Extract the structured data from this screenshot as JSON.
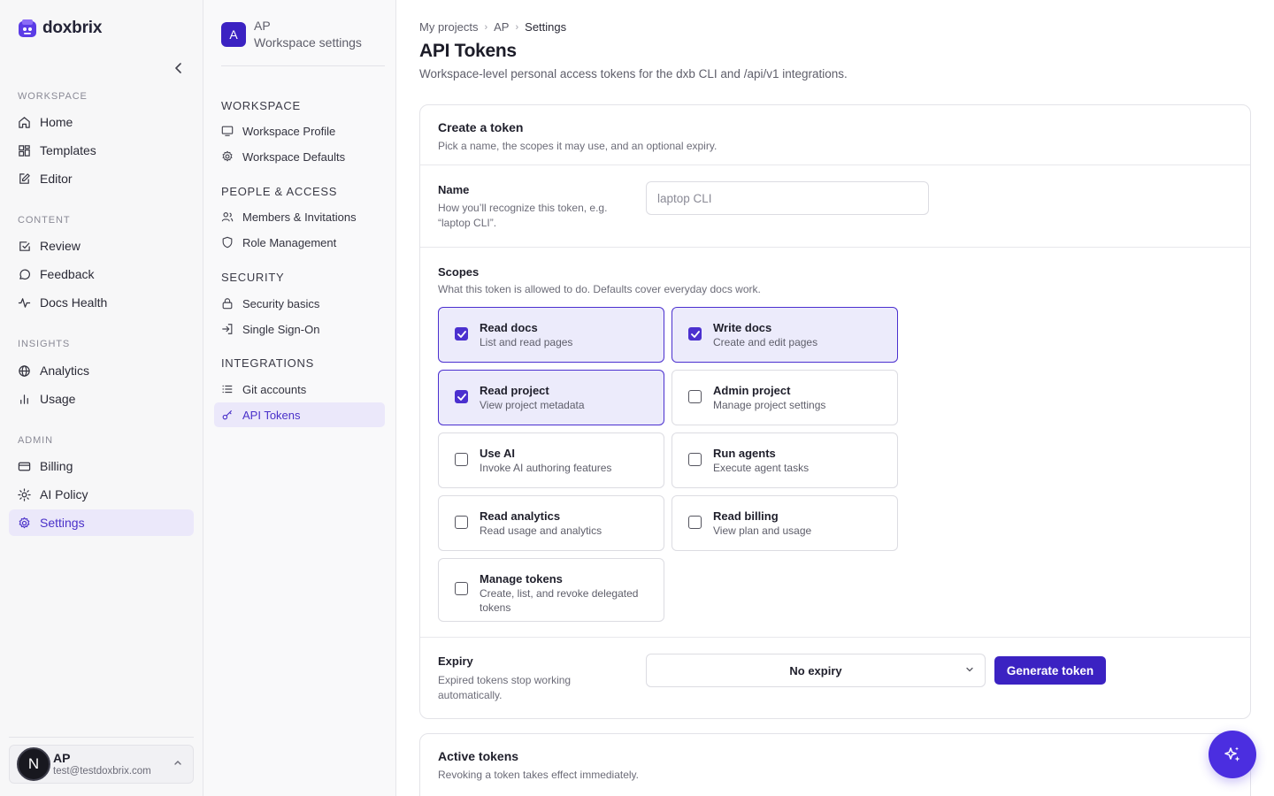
{
  "app": {
    "brand": "doxbrix",
    "colors": {
      "accent": "#3b22c2",
      "active_bg": "#ebe8fa",
      "active_text": "#4a31c9"
    }
  },
  "sidebar": {
    "sections": [
      {
        "label": "WORKSPACE",
        "items": [
          {
            "label": "Home",
            "icon": "home-icon"
          },
          {
            "label": "Templates",
            "icon": "grid-icon"
          },
          {
            "label": "Editor",
            "icon": "edit-icon"
          }
        ]
      },
      {
        "label": "CONTENT",
        "items": [
          {
            "label": "Review",
            "icon": "check-square-icon"
          },
          {
            "label": "Feedback",
            "icon": "message-icon"
          },
          {
            "label": "Docs Health",
            "icon": "pulse-icon"
          }
        ]
      },
      {
        "label": "INSIGHTS",
        "items": [
          {
            "label": "Analytics",
            "icon": "globe-icon"
          },
          {
            "label": "Usage",
            "icon": "bar-chart-icon"
          }
        ]
      },
      {
        "label": "ADMIN",
        "items": [
          {
            "label": "Billing",
            "icon": "credit-card-icon"
          },
          {
            "label": "AI Policy",
            "icon": "sun-icon"
          },
          {
            "label": "Settings",
            "icon": "gear-icon",
            "active": true
          }
        ]
      }
    ],
    "user": {
      "initial": "N",
      "name": "AP",
      "email": "test@testdoxbrix.com"
    }
  },
  "settings_nav": {
    "workspace_initial": "A",
    "workspace_name": "AP",
    "workspace_sub": "Workspace settings",
    "sections": [
      {
        "label": "WORKSPACE",
        "items": [
          {
            "label": "Workspace Profile",
            "icon": "monitor-icon"
          },
          {
            "label": "Workspace Defaults",
            "icon": "gear-icon"
          }
        ]
      },
      {
        "label": "PEOPLE & ACCESS",
        "items": [
          {
            "label": "Members & Invitations",
            "icon": "users-icon"
          },
          {
            "label": "Role Management",
            "icon": "shield-icon"
          }
        ]
      },
      {
        "label": "SECURITY",
        "items": [
          {
            "label": "Security basics",
            "icon": "lock-icon"
          },
          {
            "label": "Single Sign-On",
            "icon": "sign-in-icon"
          }
        ]
      },
      {
        "label": "INTEGRATIONS",
        "items": [
          {
            "label": "Git accounts",
            "icon": "list-icon"
          },
          {
            "label": "API Tokens",
            "icon": "key-icon",
            "active": true
          }
        ]
      }
    ]
  },
  "main": {
    "breadcrumb": [
      "My projects",
      "AP",
      "Settings"
    ],
    "title": "API Tokens",
    "subtitle": "Workspace-level personal access tokens for the dxb CLI and /api/v1 integrations.",
    "create": {
      "title": "Create a token",
      "desc": "Pick a name, the scopes it may use, and an optional expiry.",
      "name_label": "Name",
      "name_help": "How you’ll recognize this token, e.g. “laptop CLI”.",
      "name_placeholder": "laptop CLI",
      "scopes_label": "Scopes",
      "scopes_help": "What this token is allowed to do. Defaults cover everyday docs work.",
      "scopes": [
        {
          "title": "Read docs",
          "desc": "List and read pages",
          "checked": true
        },
        {
          "title": "Write docs",
          "desc": "Create and edit pages",
          "checked": true
        },
        {
          "title": "Read project",
          "desc": "View project metadata",
          "checked": true
        },
        {
          "title": "Admin project",
          "desc": "Manage project settings",
          "checked": false
        },
        {
          "title": "Use AI",
          "desc": "Invoke AI authoring features",
          "checked": false
        },
        {
          "title": "Run agents",
          "desc": "Execute agent tasks",
          "checked": false
        },
        {
          "title": "Read analytics",
          "desc": "Read usage and analytics",
          "checked": false
        },
        {
          "title": "Read billing",
          "desc": "View plan and usage",
          "checked": false
        },
        {
          "title": "Manage tokens",
          "desc": "Create, list, and revoke delegated tokens",
          "checked": false
        }
      ],
      "expiry_label": "Expiry",
      "expiry_help": "Expired tokens stop working automatically.",
      "expiry_value": "No expiry",
      "generate_label": "Generate token"
    },
    "active": {
      "title": "Active tokens",
      "desc": "Revoking a token takes effect immediately."
    }
  }
}
